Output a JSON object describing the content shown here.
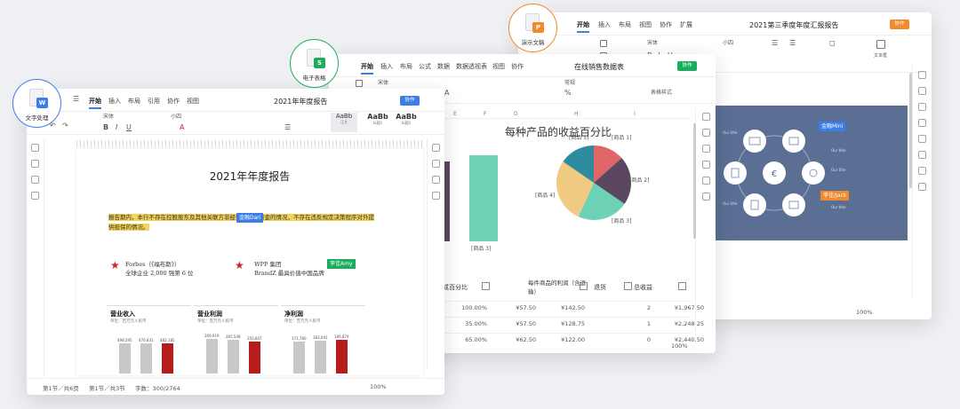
{
  "ppt": {
    "title": "2021第三季度年度汇报报告",
    "tabs": [
      "开始",
      "插入",
      "布局",
      "视图",
      "协作",
      "扩展"
    ],
    "cobtn": "协作",
    "font": "宋体",
    "size": "小四",
    "textbox": "文本框",
    "zoom": "100%",
    "slide_labels": {
      "t1": "Our title",
      "t2": "Our title",
      "t3": "Our title",
      "t4": "Our title",
      "t5": "Our title",
      "t6": "Our title",
      "c1": "Our title",
      "c2": "Our title"
    },
    "badge_top": "金融Mini",
    "badge_bot": "李佳/Jack",
    "colors": {
      "slide_bg": "#5b6f95",
      "badge_blue": "#3d7de8",
      "badge_orange": "#f08a2c"
    }
  },
  "sheet": {
    "title": "在线销售数据表",
    "tabs": [
      "开始",
      "插入",
      "布局",
      "公式",
      "数据",
      "数据透视表",
      "视图",
      "协作"
    ],
    "cobtn": "协作",
    "font": "宋体",
    "format": "常规",
    "table_style": "表格样式",
    "cols": [
      "E",
      "F",
      "G",
      "H",
      "I"
    ],
    "zoom": "100%",
    "table_headers": [
      "成百分比",
      "每件商品的利润（含运输）",
      "退货",
      "总收益"
    ],
    "table_rows": [
      [
        "100.00%",
        "¥57.50",
        "¥142.50",
        "2",
        "¥1,967.50"
      ],
      [
        "35.00%",
        "¥57.50",
        "¥128.75",
        "1",
        "¥2,248.25"
      ],
      [
        "65.00%",
        "¥62.50",
        "¥122.00",
        "0",
        "¥2,440.50"
      ]
    ],
    "colors": {
      "green": "#1aae5c",
      "teal": "#6cd1b5"
    }
  },
  "chart_data": {
    "type": "pie",
    "title": "每种产品的收益百分比",
    "categories": [
      "商品 1",
      "商品 2",
      "商品 3",
      "商品 4",
      "商品 5"
    ],
    "values": [
      14,
      22,
      23,
      29,
      16
    ],
    "colors": [
      "#e06667",
      "#5b4760",
      "#6cd1b5",
      "#f0c983",
      "#2f8c9e"
    ],
    "side_bar_labels": [
      "商品 3"
    ]
  },
  "doc": {
    "title": "2021年年度报告",
    "tabs": [
      "开始",
      "插入",
      "布局",
      "引用",
      "协作",
      "视图"
    ],
    "cobtn": "协作",
    "font": "宋体",
    "size": "小四",
    "styles": [
      {
        "sample": "AaBb",
        "name": "正文"
      },
      {
        "sample": "AaBb",
        "name": "标题1"
      },
      {
        "sample": "AaBb",
        "name": "标题2"
      }
    ],
    "heading": "2021年年度报告",
    "para": "报告期内，本行不存在控股股东及其他关联方非经营性占用资金的情况，不存在违反规定决策程序对外提供担保的情况。",
    "badge_blue": "金融Dari",
    "badge_green": "李佳Amy",
    "forbes_title": "Forbes（《福布斯》）",
    "forbes_sub": "全球企业 2,000 强第 6 位",
    "wpp_title": "WPP 集团",
    "wpp_sub": "BrandZ 最具价值中国品牌",
    "charts": [
      {
        "title": "营业收入",
        "sub": "单位：百万元人民币",
        "values": [
          "498,595",
          "476,831",
          "482,185"
        ]
      },
      {
        "title": "营业利润",
        "sub": "单位：百万元人民币",
        "values": [
          "269,919",
          "265,548",
          "250,847"
        ]
      },
      {
        "title": "净利润",
        "sub": "单位：百万元人民币",
        "values": [
          "171,780",
          "183,041",
          "186,874"
        ]
      }
    ],
    "status_left": "第1节／共6页",
    "status_mid": "第1节／共3节",
    "status_count": "字数：300/2764",
    "zoom": "100%",
    "colors": {
      "badge_blue": "#3d7de8",
      "badge_green": "#1aae5c",
      "star": "#c62828",
      "bar_grey": "#c8c8c8",
      "bar_red": "#b71c1c"
    }
  },
  "icons": [
    {
      "key": "doc",
      "label": "文字处理",
      "badge": "W",
      "ring": "#3d7de8"
    },
    {
      "key": "sheet",
      "label": "电子表格",
      "badge": "S",
      "ring": "#1aae5c"
    },
    {
      "key": "ppt",
      "label": "演示文稿",
      "badge": "P",
      "ring": "#f08a2c"
    }
  ]
}
